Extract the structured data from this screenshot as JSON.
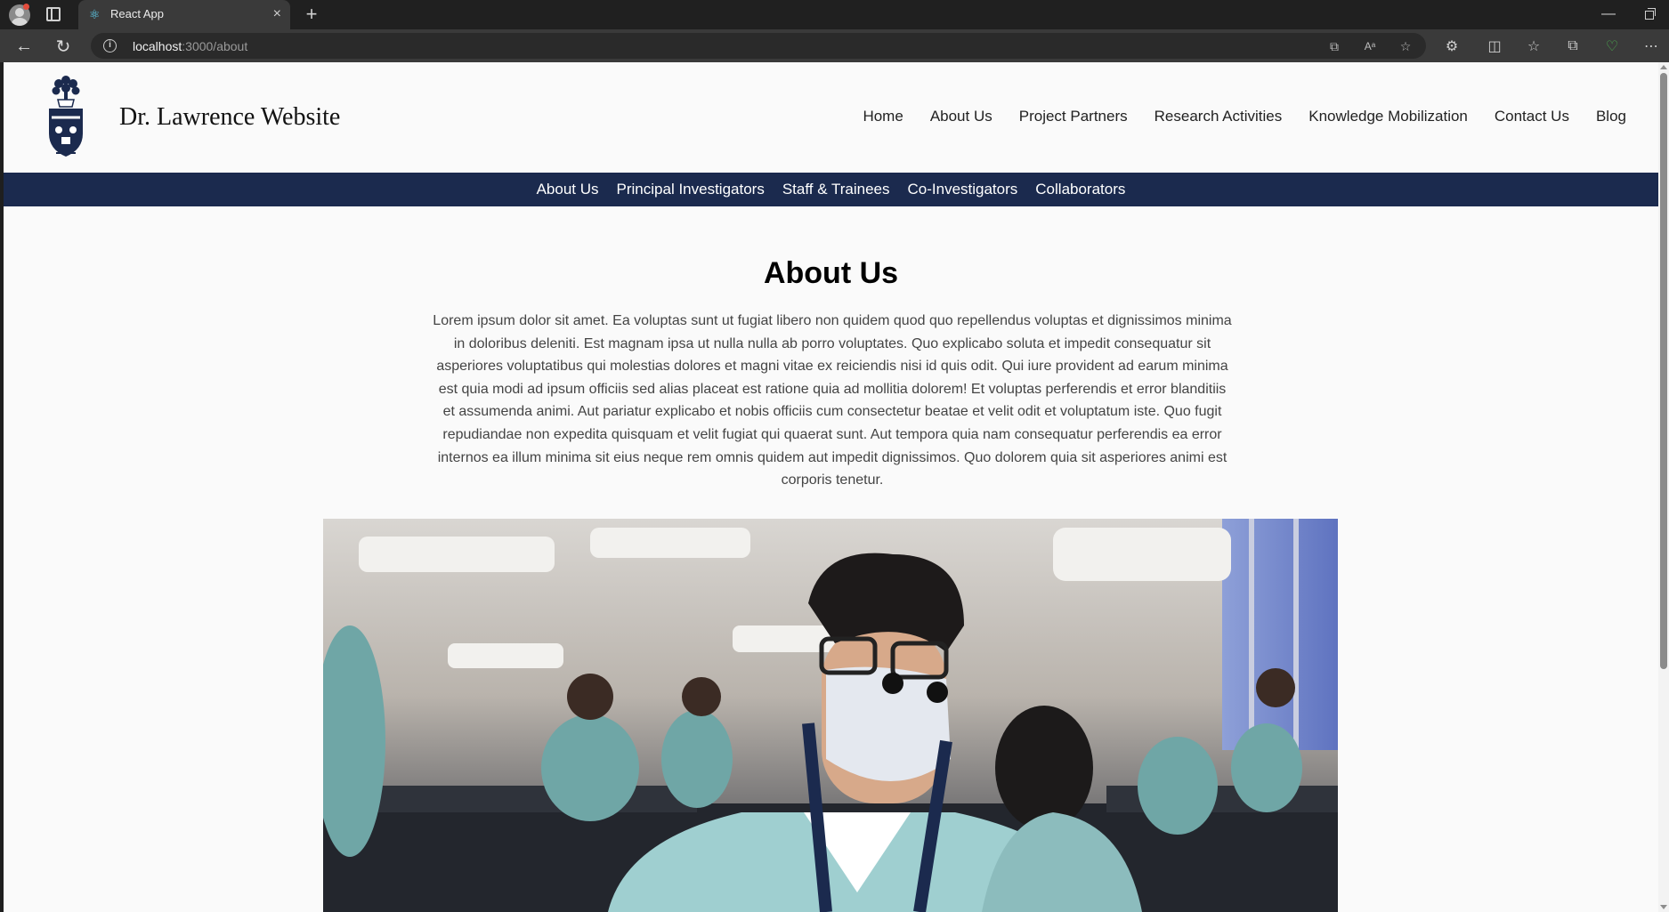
{
  "browser": {
    "tab_title": "React App",
    "url_host": "localhost",
    "url_path": ":3000/about"
  },
  "site": {
    "title": "Dr. Lawrence Website",
    "main_nav": [
      "Home",
      "About Us",
      "Project Partners",
      "Research Activities",
      "Knowledge Mobilization",
      "Contact Us",
      "Blog"
    ],
    "sub_nav": [
      "About Us",
      "Principal Investigators",
      "Staff & Trainees",
      "Co-Investigators",
      "Collaborators"
    ]
  },
  "content": {
    "heading": "About Us",
    "paragraph": "Lorem ipsum dolor sit amet. Ea voluptas sunt ut fugiat libero non quidem quod quo repellendus voluptas et dignissimos minima in doloribus deleniti. Est magnam ipsa ut nulla nulla ab porro voluptates. Quo explicabo soluta et impedit consequatur sit asperiores voluptatibus qui molestias dolores et magni vitae ex reiciendis nisi id quis odit. Qui iure provident ad earum minima est quia modi ad ipsum officiis sed alias placeat est ratione quia ad mollitia dolorem! Et voluptas perferendis et error blanditiis et assumenda animi. Aut pariatur explicabo et nobis officiis cum consectetur beatae et velit odit et voluptatum iste. Quo fugit repudiandae non expedita quisquam et velit fugiat qui quaerat sunt. Aut tempora quia nam consequatur perferendis ea error internos ea illum minima sit eius neque rem omnis quidem aut impedit dignissimos. Quo dolorem quia sit asperiores animi est corporis tenetur."
  },
  "colors": {
    "subnav_bg": "#1b2a4e",
    "page_bg": "#fafafa"
  },
  "icons": {
    "tab_favicon": "react-icon",
    "info": "info-icon"
  }
}
